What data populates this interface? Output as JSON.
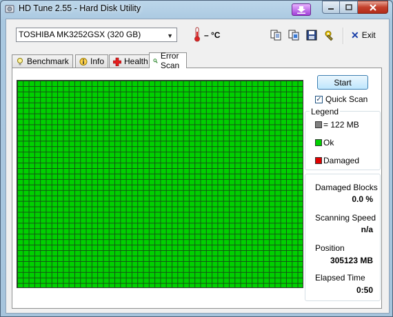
{
  "window": {
    "title": "HD Tune 2.55 - Hard Disk Utility"
  },
  "toolbar": {
    "drive": "TOSHIBA MK3252GSX (320 GB)",
    "temperature": "– °C",
    "exit_label": "Exit"
  },
  "tabs": [
    {
      "label": "Benchmark",
      "icon": "benchmark-icon"
    },
    {
      "label": "Info",
      "icon": "info-icon"
    },
    {
      "label": "Health",
      "icon": "health-cross-icon"
    },
    {
      "label": "Error Scan",
      "icon": "magnifier-icon",
      "active": true
    }
  ],
  "controls": {
    "start_label": "Start",
    "quick_scan_label": "Quick Scan",
    "quick_scan_checked": true
  },
  "legend": {
    "title": "Legend",
    "items": [
      {
        "label": "= 122 MB",
        "color": "#808080"
      },
      {
        "label": "Ok",
        "color": "#00d000"
      },
      {
        "label": "Damaged",
        "color": "#e00000"
      }
    ]
  },
  "stats": {
    "damaged_label": "Damaged Blocks",
    "damaged_value": "0.0 %",
    "speed_label": "Scanning Speed",
    "speed_value": "n/a",
    "position_label": "Position",
    "position_value": "305123 MB",
    "elapsed_label": "Elapsed Time",
    "elapsed_value": "0:50"
  },
  "colors": {
    "ok": "#00d000",
    "damaged": "#e00000",
    "accent": "#3c7fb1"
  }
}
